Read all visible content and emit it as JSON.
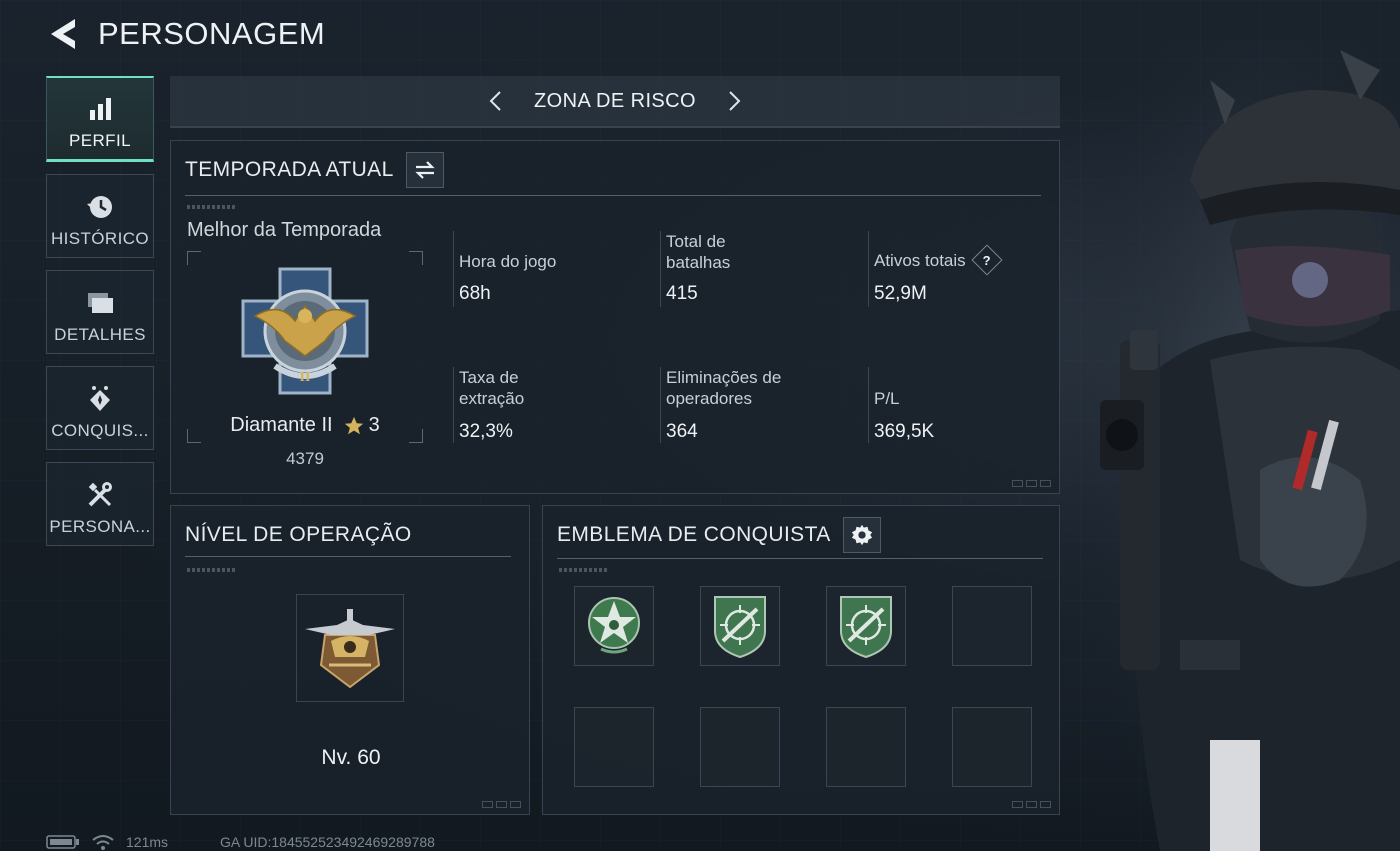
{
  "header": {
    "title": "PERSONAGEM"
  },
  "sidebar": {
    "items": [
      {
        "label": "PERFIL",
        "icon": "bar-chart-icon",
        "active": true
      },
      {
        "label": "HISTÓRICO",
        "icon": "history-icon"
      },
      {
        "label": "DETALHES",
        "icon": "folders-icon"
      },
      {
        "label": "CONQUIS...",
        "icon": "achievement-icon"
      },
      {
        "label": "PERSONA...",
        "icon": "tools-icon"
      }
    ]
  },
  "mode": {
    "label": "ZONA DE RISCO"
  },
  "season": {
    "title": "TEMPORADA ATUAL",
    "best_label": "Melhor da Temporada",
    "rank_name": "Diamante II",
    "rank_stars": "3",
    "rank_points": "4379",
    "stats": [
      {
        "label": "Hora do jogo",
        "value": "68h"
      },
      {
        "label": "Total de batalhas",
        "value": "415"
      },
      {
        "label": "Ativos totais",
        "value": "52,9M",
        "help": "?"
      },
      {
        "label": "Taxa de extração",
        "value": "32,3%"
      },
      {
        "label": "Eliminações de operadores",
        "value": "364"
      },
      {
        "label": "P/L",
        "value": "369,5K"
      }
    ]
  },
  "operation": {
    "title": "NÍVEL DE OPERAÇÃO",
    "level": "Nv. 60"
  },
  "emblems": {
    "title": "EMBLEMA DE CONQUISTA"
  },
  "status": {
    "ping": "121ms",
    "uid": "GA UID:1845525234924692897​88"
  },
  "colors": {
    "accent": "#6fe0c2",
    "panel_border": "#39434f",
    "background": "#141c25"
  }
}
